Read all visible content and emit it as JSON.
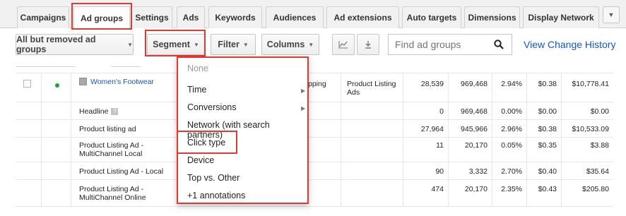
{
  "tabs": [
    "Campaigns",
    "Ad groups",
    "Settings",
    "Ads",
    "Keywords",
    "Audiences",
    "Ad extensions",
    "Auto targets",
    "Dimensions",
    "Display Network"
  ],
  "active_tab": "Ad groups",
  "toolbar": {
    "filter_status": "All but removed ad groups",
    "segment": "Segment",
    "filter": "Filter",
    "columns": "Columns",
    "search_placeholder": "Find ad groups",
    "view_history": "View Change History"
  },
  "menu": {
    "items": [
      "None",
      "Time",
      "Conversions",
      "Network (with search partners)",
      "Click type",
      "Device",
      "Top vs. Other",
      "+1 annotations"
    ],
    "highlighted": "Click type"
  },
  "rows": [
    {
      "name": "Women's Footwear",
      "partial": "pping",
      "type": "Product Listing Ads",
      "c1": "28,539",
      "c2": "969,468",
      "c3": "2.94%",
      "c4": "$0.38",
      "c5": "$10,778.41"
    },
    {
      "name": "Headline",
      "partial": "",
      "type": "",
      "c1": "0",
      "c2": "969,468",
      "c3": "0.00%",
      "c4": "$0.00",
      "c5": "$0.00"
    },
    {
      "name": "Product listing ad",
      "partial": "",
      "type": "",
      "c1": "27,964",
      "c2": "945,966",
      "c3": "2.96%",
      "c4": "$0.38",
      "c5": "$10,533.09"
    },
    {
      "name": "Product Listing Ad - MultiChannel Local",
      "partial": "",
      "type": "",
      "c1": "11",
      "c2": "20,170",
      "c3": "0.05%",
      "c4": "$0.35",
      "c5": "$3.88"
    },
    {
      "name": "Product Listing Ad - Local",
      "partial": "",
      "type": "",
      "c1": "90",
      "c2": "3,332",
      "c3": "2.70%",
      "c4": "$0.40",
      "c5": "$35.64"
    },
    {
      "name": "Product Listing Ad - MultiChannel Online",
      "partial": "",
      "type": "",
      "c1": "474",
      "c2": "20,170",
      "c3": "2.35%",
      "c4": "$0.43",
      "c5": "$205.80"
    }
  ],
  "colors": {
    "highlight": "#e03a32",
    "link": "#1155cc",
    "status_dot": "#18a43a"
  }
}
